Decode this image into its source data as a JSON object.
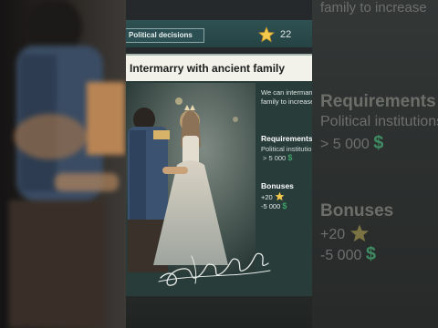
{
  "header": {
    "tab_label": "Political decisions",
    "star_icon": "star-icon",
    "stars": "22"
  },
  "decision": {
    "title": "Intermarry with ancient family",
    "description_line1": "We can intermarry",
    "description_line2": "family to increase",
    "requirements_label": "Requirements",
    "requirement_text": "Political institutions",
    "requirement_value": "> 5 000",
    "bonuses_label": "Bonuses",
    "bonus_stars": "+20",
    "bonus_money": "-5 000",
    "currency_symbol": "$"
  },
  "echo": {
    "description": "family to increase",
    "requirements_label": "Requirements",
    "requirement_text": "Political institutions",
    "requirement_value": "> 5 000",
    "bonuses_label": "Bonuses",
    "bonus_stars": "+20",
    "bonus_money": "-5 000",
    "currency_symbol": "$"
  },
  "colors": {
    "accent_teal": "#2b4f52",
    "money_green": "#3fa06a",
    "star_gold": "#f2c94c"
  }
}
